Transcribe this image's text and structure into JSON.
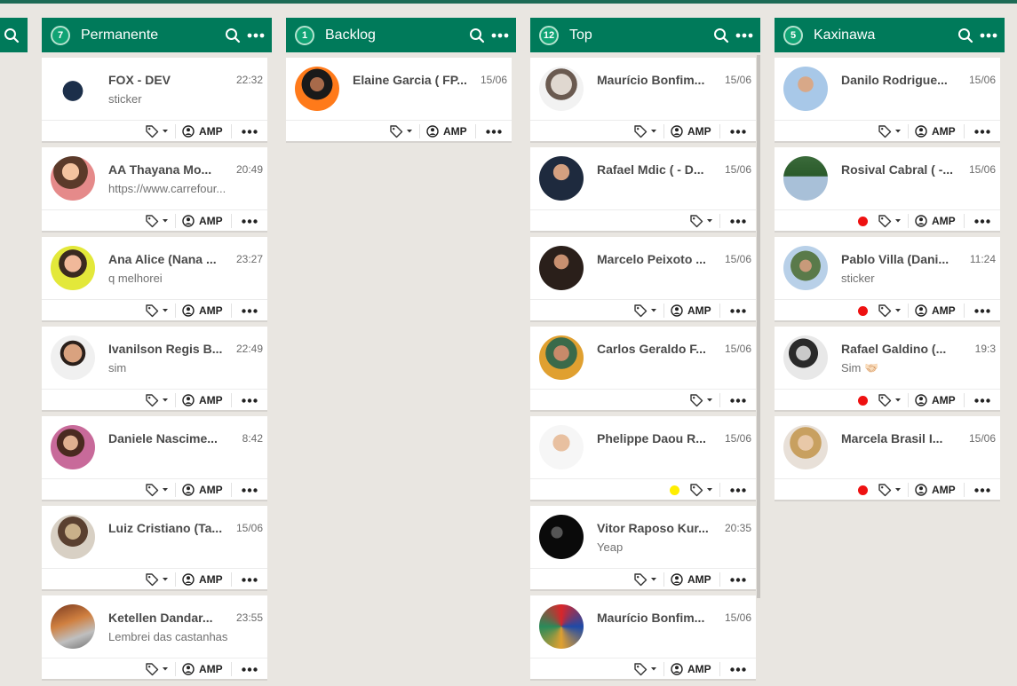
{
  "columns": [
    {
      "count": "7",
      "title": "Permanente",
      "cards": [
        {
          "name": "FOX - DEV",
          "time": "22:32",
          "message": "sticker",
          "dot": ""
        },
        {
          "name": "AA Thayana Mo...",
          "time": "20:49",
          "message": "https://www.carrefour...",
          "dot": ""
        },
        {
          "name": "Ana Alice (Nana ...",
          "time": "23:27",
          "message": "q melhorei",
          "dot": ""
        },
        {
          "name": "Ivanilson Regis B...",
          "time": "22:49",
          "message": "sim",
          "dot": ""
        },
        {
          "name": "Daniele Nascime...",
          "time": "8:42",
          "message": "",
          "dot": ""
        },
        {
          "name": "Luiz Cristiano (Ta...",
          "time": "15/06",
          "message": "",
          "dot": ""
        },
        {
          "name": "Ketellen Dandar...",
          "time": "23:55",
          "message": "Lembrei das castanhas",
          "dot": ""
        }
      ]
    },
    {
      "count": "1",
      "title": "Backlog",
      "cards": [
        {
          "name": "Elaine Garcia ( FP...",
          "time": "15/06",
          "message": "",
          "dot": ""
        }
      ]
    },
    {
      "count": "12",
      "title": "Top",
      "cards": [
        {
          "name": "Maurício Bonfim...",
          "time": "15/06",
          "message": "",
          "dot": ""
        },
        {
          "name": "Rafael Mdic ( - D...",
          "time": "15/06",
          "message": "",
          "dot": ""
        },
        {
          "name": "Marcelo Peixoto ...",
          "time": "15/06",
          "message": "",
          "dot": ""
        },
        {
          "name": "Carlos Geraldo F...",
          "time": "15/06",
          "message": "",
          "dot": ""
        },
        {
          "name": "Phelippe Daou R...",
          "time": "15/06",
          "message": "",
          "dot": "#ffee00"
        },
        {
          "name": "Vitor Raposo Kur...",
          "time": "20:35",
          "message": "Yeap",
          "dot": ""
        },
        {
          "name": "Maurício Bonfim...",
          "time": "15/06",
          "message": "",
          "dot": ""
        }
      ]
    },
    {
      "count": "5",
      "title": "Kaxinawa",
      "cards": [
        {
          "name": "Danilo Rodrigue...",
          "time": "15/06",
          "message": "",
          "dot": ""
        },
        {
          "name": "Rosival Cabral ( -...",
          "time": "15/06",
          "message": "",
          "dot": "#ee1111"
        },
        {
          "name": "Pablo Villa (Dani...",
          "time": "11:24",
          "message": "sticker",
          "dot": "#ee1111"
        },
        {
          "name": "Rafael Galdino (...",
          "time": "19:3",
          "message": "Sim 🤝🏻",
          "dot": "#ee1111"
        },
        {
          "name": "Marcela Brasil I...",
          "time": "15/06",
          "message": "",
          "dot": "#ee1111"
        }
      ]
    }
  ],
  "assignee_label": "AMP",
  "theme": {
    "header_bg": "#007a5a",
    "badge_bg": "#10a374",
    "board_bg": "#e9e6e1"
  },
  "icons": {
    "search": "search-icon",
    "more": "more-horizontal-icon",
    "tag": "tag-icon",
    "user": "user-circle-icon"
  }
}
